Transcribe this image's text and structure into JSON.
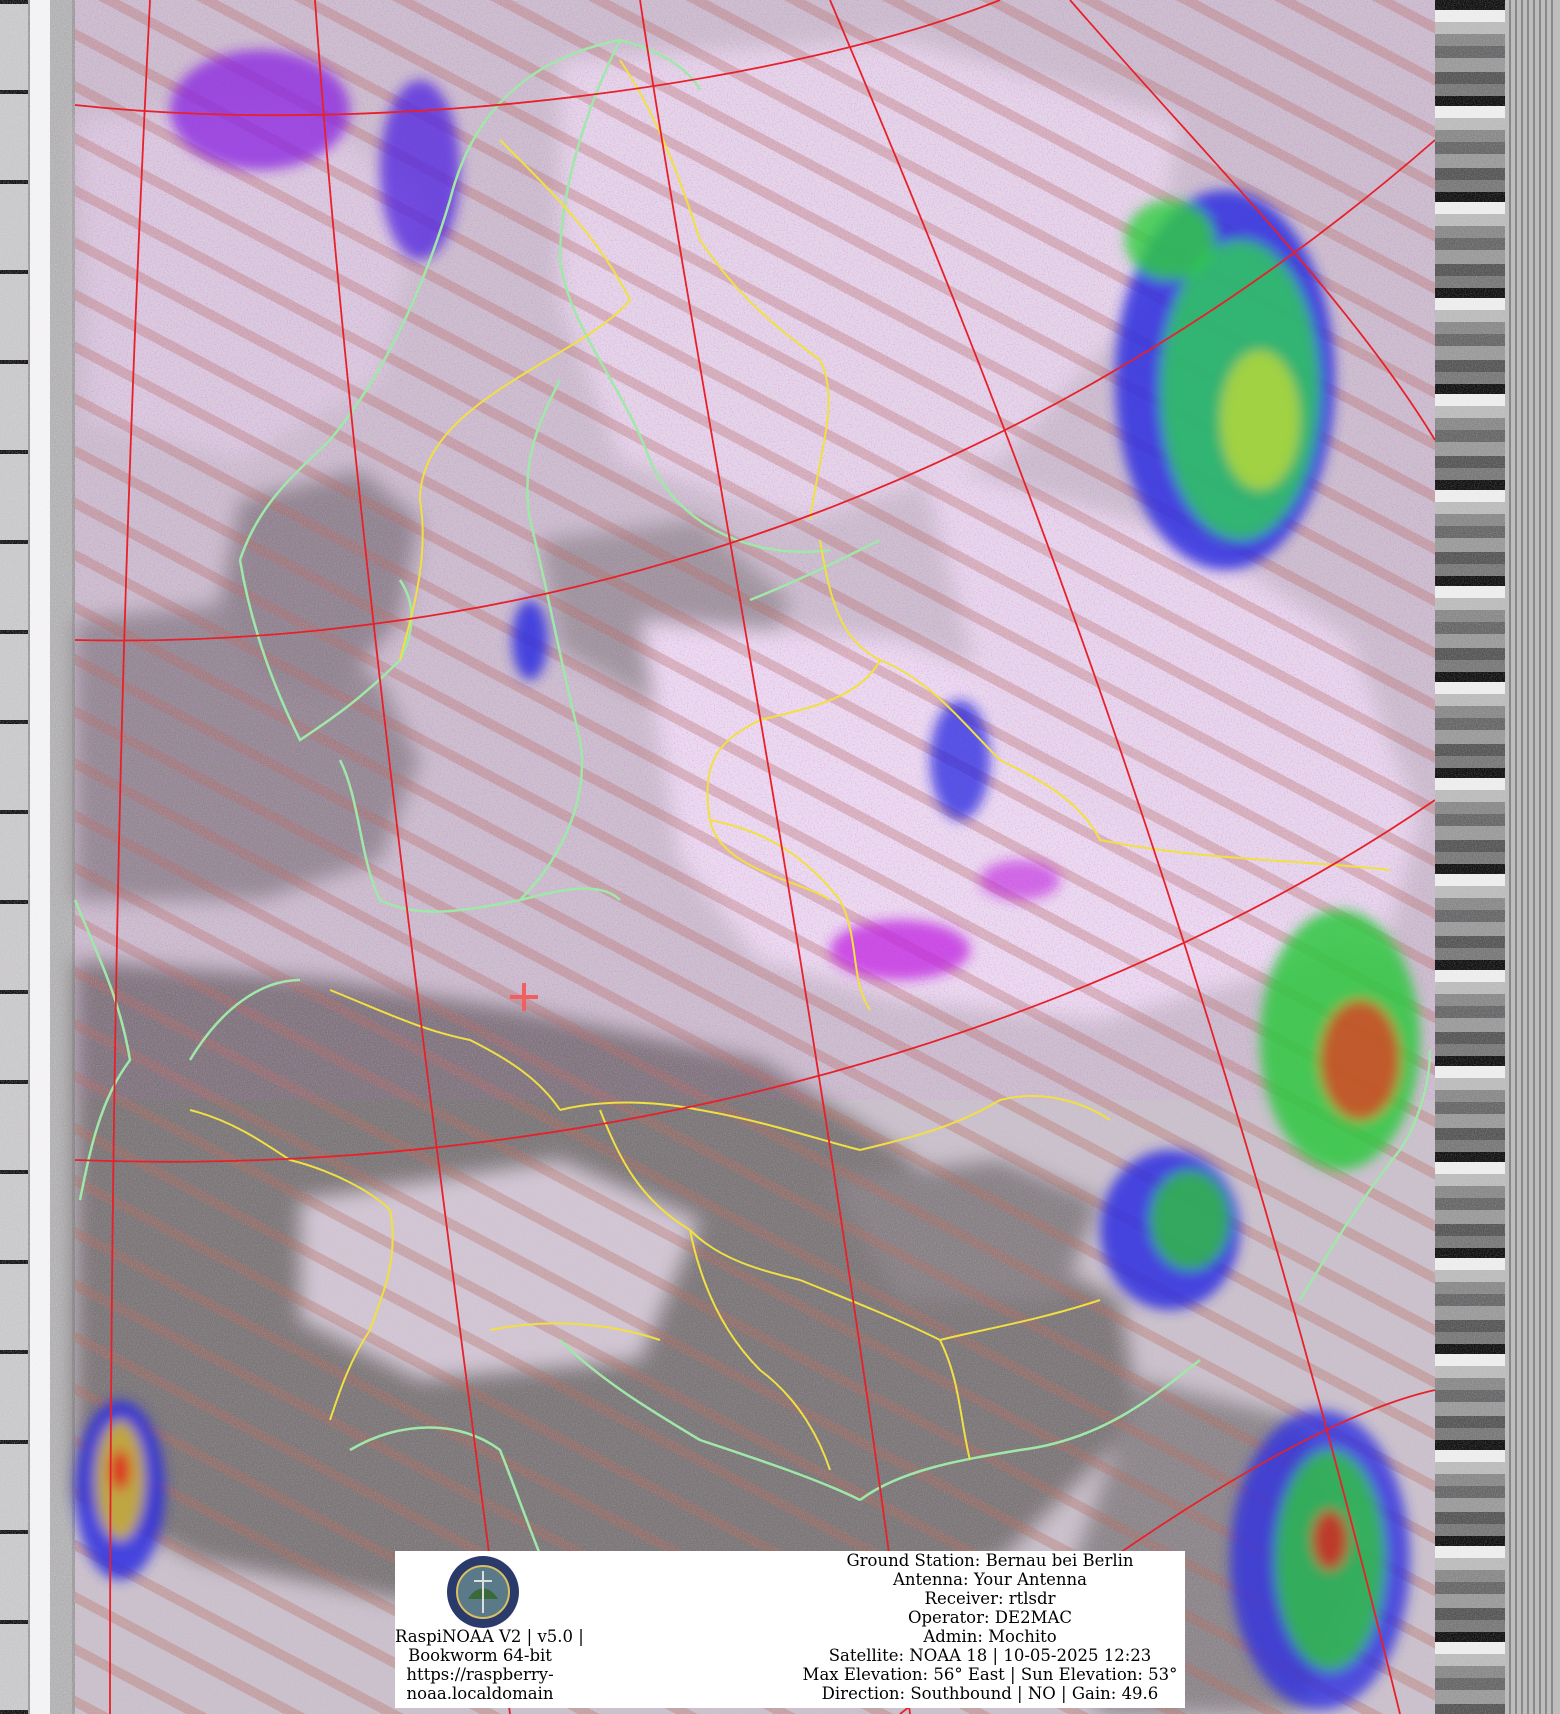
{
  "station": {
    "ground_station": "Ground Station: Bernau bei Berlin",
    "antenna": "Antenna: Your Antenna",
    "receiver": "Receiver: rtlsdr",
    "operator": "Operator: DE2MAC",
    "admin": "Admin: Mochito",
    "satellite": "Satellite: NOAA 18 | 10-05-2025 12:23",
    "elevation": "Max Elevation: 56° East | Sun Elevation: 53°",
    "direction": "Direction: Southbound | NO | Gain: 49.6"
  },
  "software": {
    "line1": "RaspiNOAA V2 | v5.0 |",
    "line2": "Bookworm 64-bit",
    "line3": "https://raspberry-",
    "line4": "noaa.localdomain"
  },
  "colors": {
    "grid": "#e8202a",
    "coastline": "#9fe8a8",
    "borders": "#f2e042",
    "cloud_light": "#e6d8ea",
    "cloud_magenta": "#c020e0",
    "land_gray": "#7a7476",
    "precip_green": "#30d040",
    "precip_blue": "#3030e0",
    "precip_red": "#e02020",
    "marker": "#f06060"
  },
  "icons": {
    "logo": "weather-satellite-logo-icon",
    "marker": "crosshair-marker-icon"
  }
}
